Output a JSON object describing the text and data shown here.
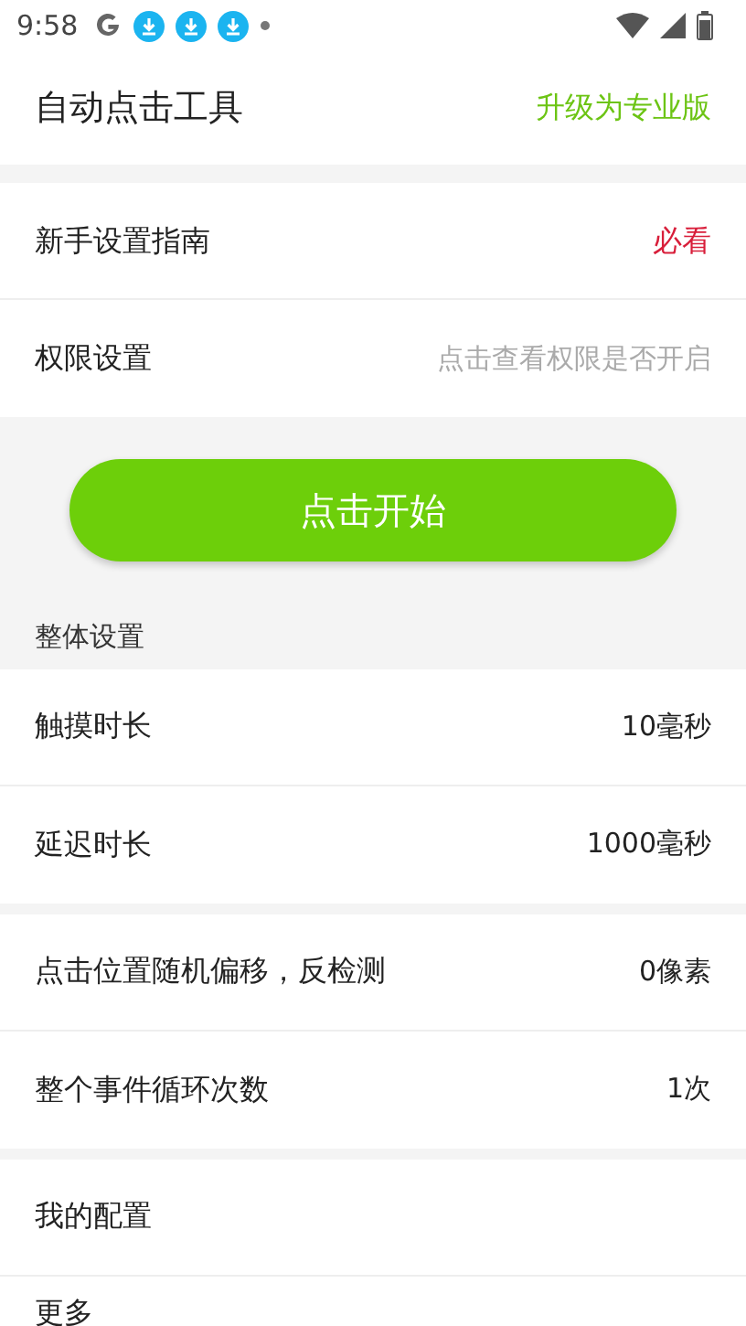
{
  "status_bar": {
    "time": "9:58",
    "icons": [
      {
        "kind": "google"
      },
      {
        "kind": "download"
      },
      {
        "kind": "download"
      },
      {
        "kind": "download"
      },
      {
        "kind": "dot"
      }
    ]
  },
  "header": {
    "title": "自动点击工具",
    "action": "升级为专业版"
  },
  "groups": [
    {
      "rows": [
        {
          "label": "新手设置指南",
          "value": "必看",
          "kind": "alert"
        },
        {
          "label": "权限设置",
          "value": "点击查看权限是否开启",
          "kind": "hint"
        }
      ]
    },
    {
      "button": "点击开始",
      "section_title": "整体设置"
    },
    {
      "rows": [
        {
          "label": "触摸时长",
          "value": "10毫秒",
          "kind": "value"
        },
        {
          "label": "延迟时长",
          "value": "1000毫秒",
          "kind": "value"
        }
      ]
    },
    {
      "rows": [
        {
          "label": "点击位置随机偏移，反检测",
          "value": "0像素",
          "kind": "value"
        },
        {
          "label": "整个事件循环次数",
          "value": "1次",
          "kind": "value"
        }
      ]
    },
    {
      "rows": [
        {
          "label": "我的配置"
        },
        {
          "label": "更多"
        }
      ]
    }
  ]
}
